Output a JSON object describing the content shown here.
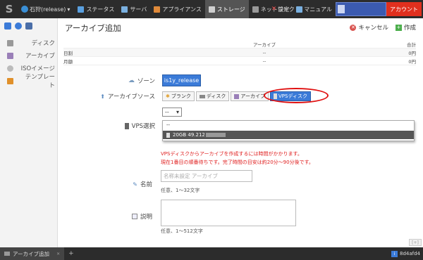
{
  "topbar": {
    "zone_label": "石狩(release)",
    "nav": [
      {
        "label": "ステータス",
        "color": "#5aa0e0"
      },
      {
        "label": "サーバ",
        "color": "#7ab0e0"
      },
      {
        "label": "アプライアンス",
        "color": "#e08a3a"
      },
      {
        "label": "ストレージ",
        "color": "#cfcfcf"
      },
      {
        "label": "ネットワーク",
        "color": "#999999"
      }
    ],
    "settings_label": "設定",
    "manual_label": "マニュアル",
    "account_label": "アカウント"
  },
  "sidebar": {
    "items": [
      {
        "label": "ディスク"
      },
      {
        "label": "アーカイブ"
      },
      {
        "label": "ISOイメージ"
      },
      {
        "label": "テンプレート"
      }
    ]
  },
  "main": {
    "title": "アーカイブ追加",
    "cancel_label": "キャンセル",
    "create_label": "作成",
    "fee": {
      "header": {
        "c1": "",
        "c2": "アーカイブ",
        "c3": "合計"
      },
      "rows": [
        {
          "label": "日割",
          "value": "--",
          "total": "0円"
        },
        {
          "label": "月額",
          "value": "--",
          "total": "0円"
        }
      ]
    },
    "zone": {
      "label": "ゾーン",
      "value": "is1y_release"
    },
    "source": {
      "label": "アーカイブソース",
      "options": [
        "ブランク",
        "ディスク",
        "アーカイブ",
        "VPSディスク"
      ],
      "selected": "VPSディスク"
    },
    "vps": {
      "label": "VPS選択",
      "selected": "--",
      "options": [
        "--",
        "20GB 49.212"
      ]
    },
    "warning": [
      "VPSディスクからアーカイブを作成するには時間がかかります。",
      "現在1番目の順番待ちです。完了時間の目安は約20分〜90分後です。"
    ],
    "name": {
      "label": "名前",
      "placeholder": "名称未設定 アーカイブ",
      "hint": "任意、1〜32文字"
    },
    "description": {
      "label": "説明",
      "hint": "任意、1〜512文字"
    }
  },
  "bottombar": {
    "tab_label": "アーカイブ追加",
    "add_label": "+",
    "session_id": "8d4afd4"
  },
  "colors": {
    "accent": "#3b7bd8",
    "account": "#e0301e",
    "warning": "#e02020",
    "highlight_ring": "#e01010"
  }
}
